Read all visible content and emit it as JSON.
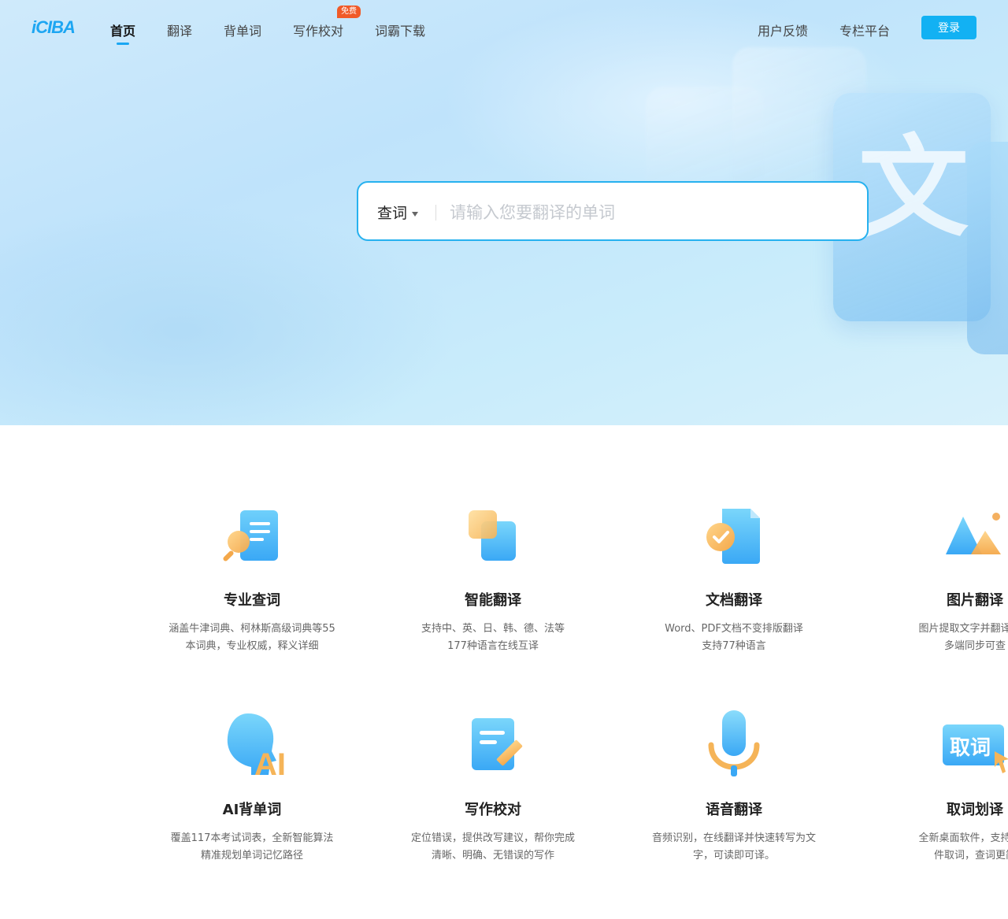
{
  "nav": {
    "logo": "iCIBA",
    "items": [
      "首页",
      "翻译",
      "背单词",
      "写作校对",
      "词霸下载"
    ],
    "free_badge": "免费",
    "right_items": [
      "用户反馈",
      "专栏平台"
    ],
    "login_label": "登录"
  },
  "hero": {
    "glyph": "文"
  },
  "search": {
    "type_label": "查词",
    "placeholder": "请输入您要翻译的单词"
  },
  "features": [
    {
      "title": "专业查词",
      "desc": "涵盖牛津词典、柯林斯高级词典等55\n本词典，专业权威，释义详细",
      "icon": "magnifier-doc-icon"
    },
    {
      "title": "智能翻译",
      "desc": "支持中、英、日、韩、德、法等\n177种语言在线互译",
      "icon": "overlap-squares-icon"
    },
    {
      "title": "文档翻译",
      "desc": "Word、PDF文档不变排版翻译\n支持77种语言",
      "icon": "document-check-icon"
    },
    {
      "title": "图片翻译",
      "desc": "图片提取文字并翻译，翻\n多端同步可查",
      "icon": "mountain-image-icon"
    },
    {
      "title": "AI背单词",
      "desc": "覆盖117本考试词表，全新智能算法\n精准规划单词记忆路径",
      "icon": "ai-head-icon"
    },
    {
      "title": "写作校对",
      "desc": "定位错误，提供改写建议，帮你完成\n清晰、明确、无错误的写作",
      "icon": "doc-pencil-icon"
    },
    {
      "title": "语音翻译",
      "desc": "音频识别，在线翻译并快速转写为文\n字，可读即可译。",
      "icon": "microphone-icon"
    },
    {
      "title": "取词划译",
      "desc": "全新桌面软件，支持浏览\n件取词，查词更简",
      "icon": "quci-cursor-icon",
      "icon_text": "取词"
    }
  ],
  "colors": {
    "accent": "#12b1f3",
    "badge": "#f05a28"
  }
}
